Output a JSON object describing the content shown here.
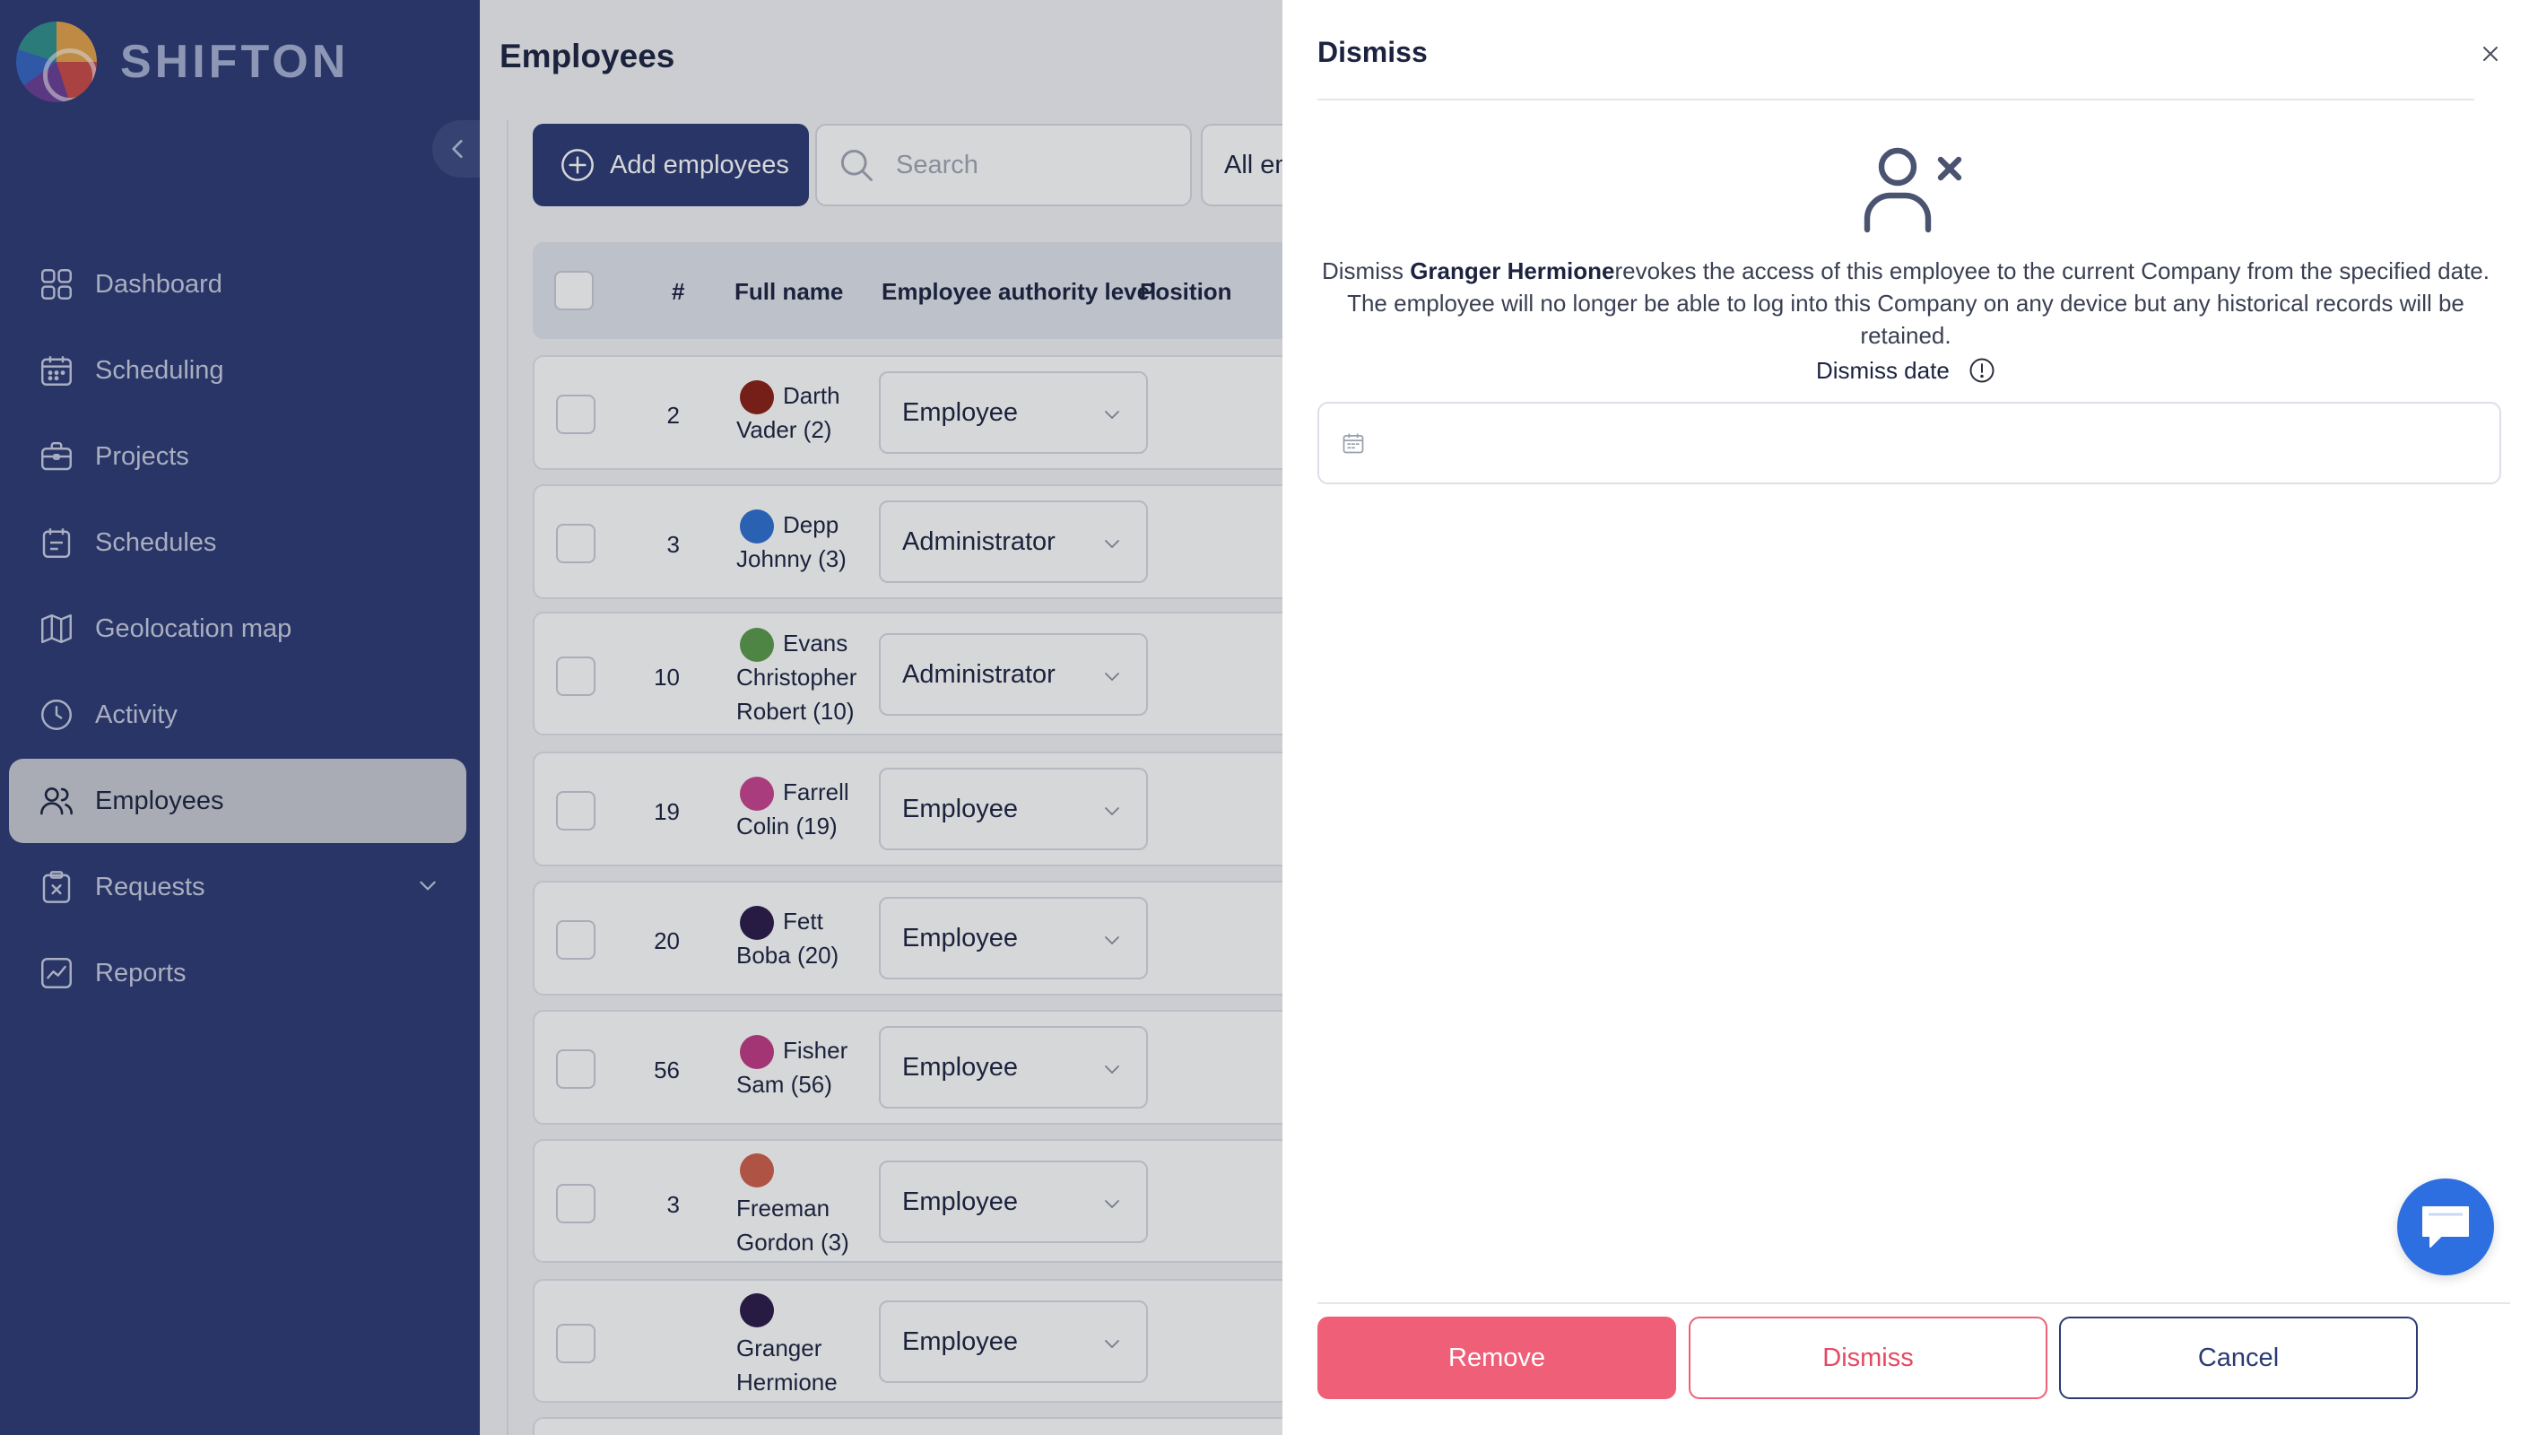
{
  "brand": {
    "name": "SHIFTON"
  },
  "sidebar": {
    "items": [
      {
        "label": "Dashboard",
        "icon": "dashboard-icon"
      },
      {
        "label": "Scheduling",
        "icon": "calendar-icon"
      },
      {
        "label": "Projects",
        "icon": "briefcase-icon"
      },
      {
        "label": "Schedules",
        "icon": "schedule-icon"
      },
      {
        "label": "Geolocation map",
        "icon": "map-icon"
      },
      {
        "label": "Activity",
        "icon": "clock-icon"
      },
      {
        "label": "Employees",
        "icon": "users-icon",
        "active": true
      },
      {
        "label": "Requests",
        "icon": "request-icon",
        "expandable": true
      },
      {
        "label": "Reports",
        "icon": "reports-icon"
      }
    ]
  },
  "main": {
    "title": "Employees",
    "add_label": "Add employees",
    "search_placeholder": "Search",
    "filter_label": "All employees",
    "columns": {
      "number": "#",
      "full_name": "Full name",
      "authority": "Employee authority level",
      "position": "Position"
    },
    "rows": [
      {
        "number": "2",
        "name_first": "Darth",
        "name_rest": "Vader (2)",
        "authority": "Employee",
        "avatar_color": "#8a1f14"
      },
      {
        "number": "3",
        "name_first": "Depp",
        "name_rest": "Johnny (3)",
        "authority": "Administrator",
        "avatar_color": "#2f6fd0"
      },
      {
        "number": "10",
        "name_first": "Evans",
        "name_rest": "Christopher Robert (10)",
        "authority": "Administrator",
        "avatar_color": "#5a9a4a"
      },
      {
        "number": "19",
        "name_first": "Farrell",
        "name_rest": "Colin (19)",
        "authority": "Employee",
        "avatar_color": "#c8428e"
      },
      {
        "number": "20",
        "name_first": "Fett",
        "name_rest": "Boba (20)",
        "authority": "Employee",
        "avatar_color": "#2a1a4a"
      },
      {
        "number": "56",
        "name_first": "Fisher",
        "name_rest": "Sam (56)",
        "authority": "Employee",
        "avatar_color": "#c23a86"
      },
      {
        "number": "3",
        "name_first": "",
        "name_rest": "Freeman Gordon (3)",
        "authority": "Employee",
        "avatar_color": "#d0604a"
      },
      {
        "number": "",
        "name_first": "",
        "name_rest": "Granger Hermione",
        "authority": "Employee",
        "avatar_color": "#2a1a4a"
      }
    ]
  },
  "modal": {
    "title": "Dismiss",
    "desc_prefix": "Dismiss ",
    "employee_name": "Granger Hermione",
    "desc_suffix": "revokes the access of this employee to the current Company from the specified date. The employee will no longer be able to log into this Company on any device but any historical records will be retained.",
    "date_label": "Dismiss date",
    "date_value": "",
    "buttons": {
      "remove": "Remove",
      "dismiss": "Dismiss",
      "cancel": "Cancel"
    }
  },
  "colors": {
    "sidebar_bg": "#2b3a73",
    "primary": "#2b3a73",
    "danger": "#ef5f78",
    "chat": "#2d6fe0"
  }
}
